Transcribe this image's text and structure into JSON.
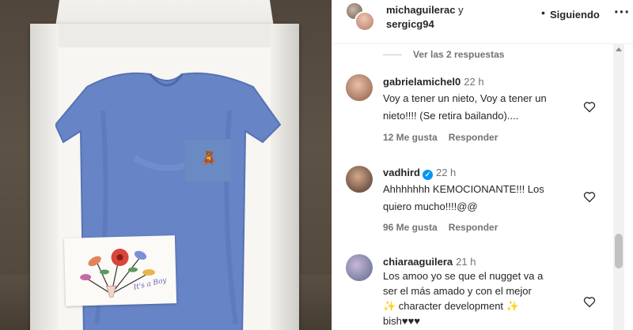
{
  "post": {
    "author_1": "michaguilerac",
    "conjunction": "y",
    "author_2": "sergicg94",
    "dot": "•",
    "follow_label": "Siguiendo",
    "more_label": "···"
  },
  "photo": {
    "card_text": "It's a Boy",
    "onesie_color": "#6684c6",
    "bear_glyph": "🧸"
  },
  "replies": {
    "label": "Ver las 2 respuestas"
  },
  "comments": [
    {
      "username": "gabrielamichel0",
      "time": "22 h",
      "verified": false,
      "text_lines": [
        "Voy a tener un nieto, Voy a tener un",
        "nieto!!!! (Se retira bailando)...."
      ],
      "likes": "12 Me gusta",
      "reply": "Responder"
    },
    {
      "username": "vadhird",
      "time": "22 h",
      "verified": true,
      "text_lines": [
        "Ahhhhhhh KEMOCIONANTE!!! Los",
        "quiero mucho!!!!@@"
      ],
      "likes": "96 Me gusta",
      "reply": "Responder"
    },
    {
      "username": "chiaraaguilera",
      "time": "21 h",
      "verified": false,
      "text_lines": [
        "Los amoo yo se que el nugget va a",
        "ser el más amado y con el mejor",
        "✨ character development ✨",
        "bish♥♥♥"
      ]
    }
  ],
  "icons": {
    "heart": "heart-outline-icon",
    "verified": "verified-badge-icon"
  },
  "colors": {
    "text_primary": "#262626",
    "text_secondary": "#737373",
    "verified_blue": "#0095f6"
  }
}
